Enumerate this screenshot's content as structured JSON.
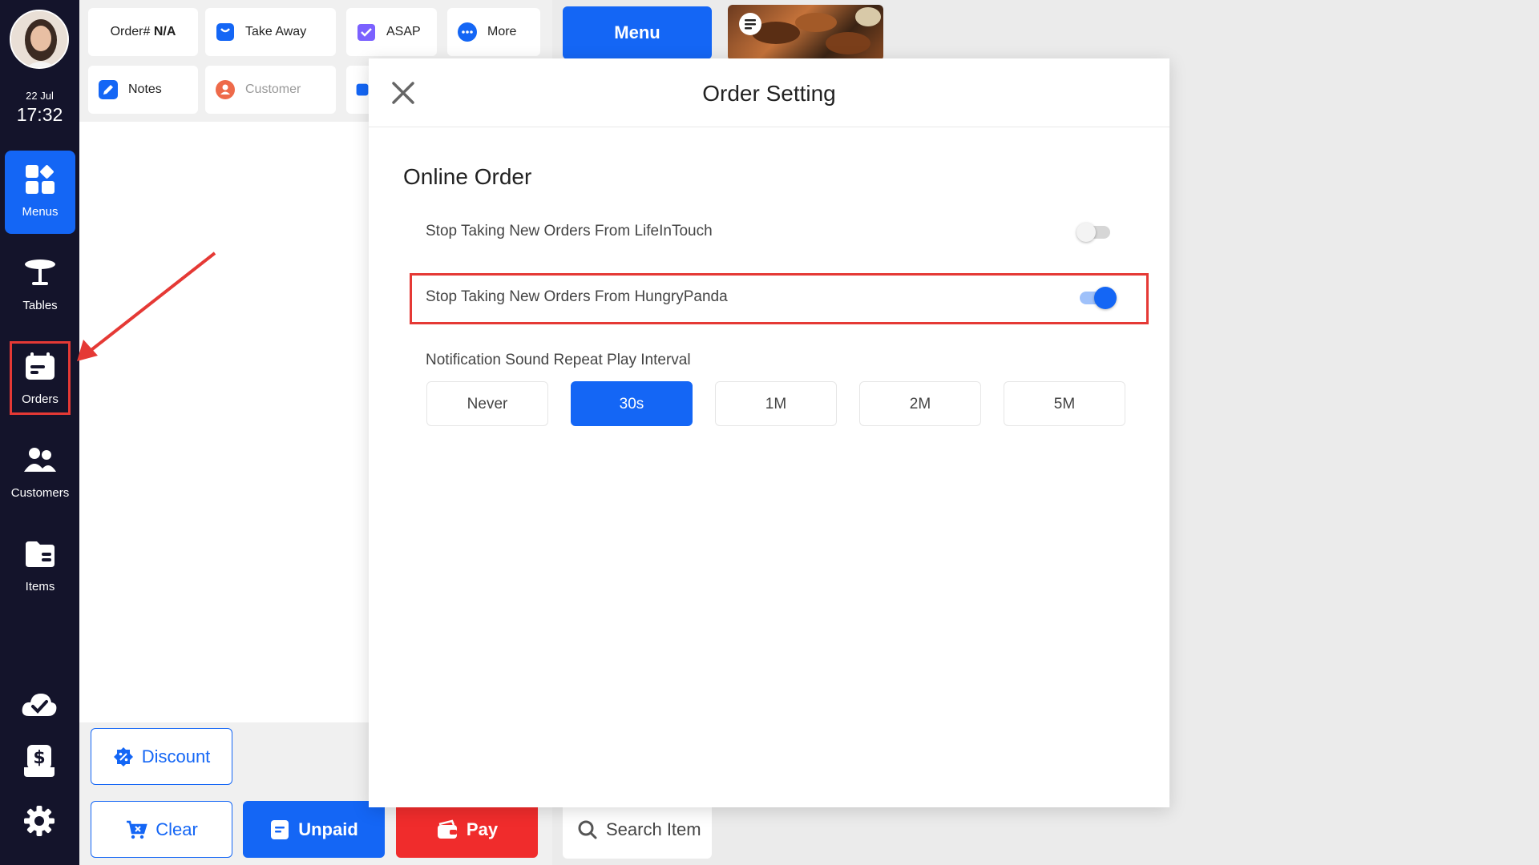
{
  "sidebar": {
    "date": "22 Jul",
    "time": "17:32",
    "items": [
      {
        "label": "Menus",
        "icon": "menus-icon"
      },
      {
        "label": "Tables",
        "icon": "table-icon"
      },
      {
        "label": "Orders",
        "icon": "orders-icon"
      },
      {
        "label": "Customers",
        "icon": "customers-icon"
      },
      {
        "label": "Items",
        "icon": "items-icon"
      }
    ],
    "bottom_icons": [
      "cloud-check-icon",
      "cash-drawer-icon",
      "gear-icon"
    ]
  },
  "order_header": {
    "order_prefix": "Order# ",
    "order_number": "N/A",
    "take_away": "Take Away",
    "asap": "ASAP",
    "more": "More",
    "notes": "Notes",
    "customer": "Customer"
  },
  "actions": {
    "discount": "Discount",
    "clear": "Clear",
    "unpaid": "Unpaid",
    "pay": "Pay"
  },
  "menu_area": {
    "menu_button": "Menu",
    "search_placeholder": "Search Item"
  },
  "modal": {
    "title": "Order Setting",
    "section": "Online Order",
    "settings": [
      {
        "label": "Stop Taking New Orders From LifeInTouch",
        "enabled": false
      },
      {
        "label": "Stop Taking New Orders From HungryPanda",
        "enabled": true
      }
    ],
    "interval_label": "Notification Sound Repeat Play Interval",
    "intervals": [
      "Never",
      "30s",
      "1M",
      "2M",
      "5M"
    ],
    "selected_interval": "30s"
  },
  "colors": {
    "accent": "#1466f5",
    "sidebar": "#14142b",
    "danger": "#f02c2c",
    "annotation": "#e53935"
  }
}
